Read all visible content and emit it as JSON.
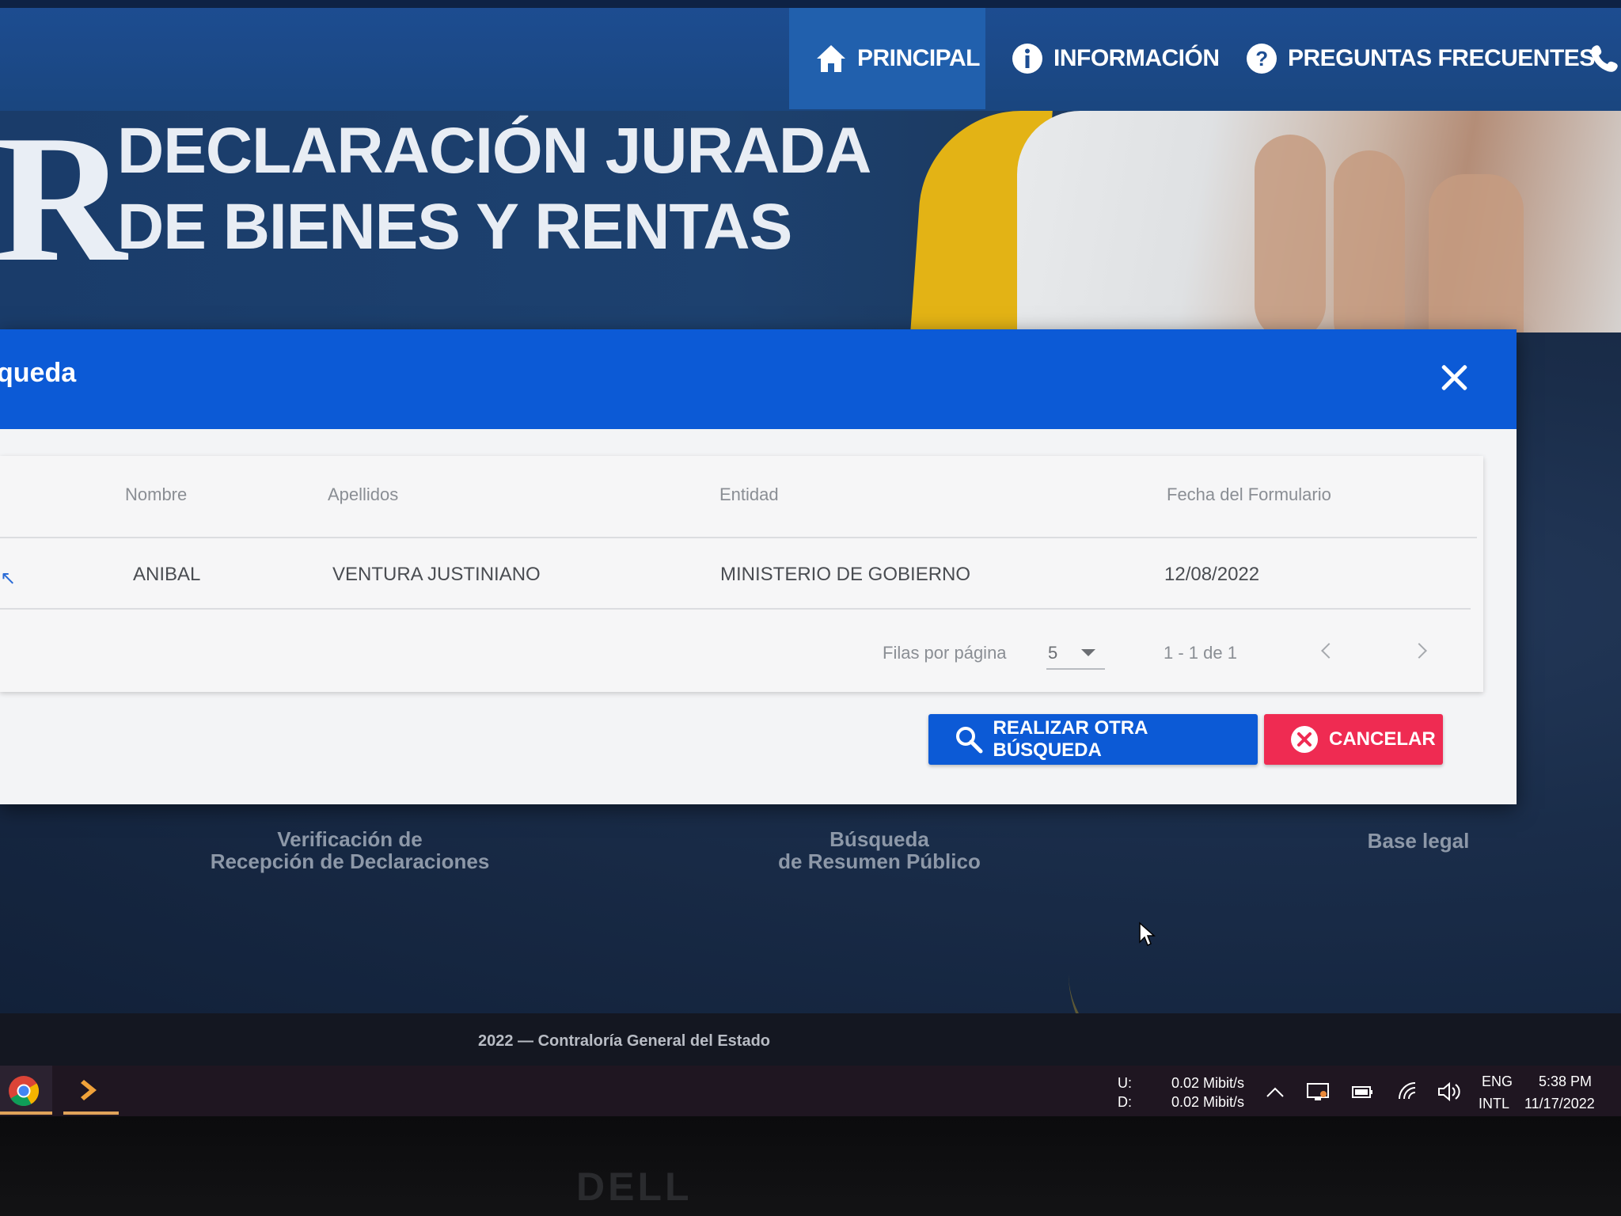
{
  "nav": {
    "principal": "PRINCIPAL",
    "informacion": "INFORMACIÓN",
    "preguntas": "PREGUNTAS FRECUENTES"
  },
  "banner": {
    "logo_letter": "R",
    "title_line1": "DECLARACIÓN JURADA",
    "title_line2": "DE BIENES Y RENTAS"
  },
  "modal": {
    "title": "queda",
    "table": {
      "headers": [
        "Nombre",
        "Apellidos",
        "Entidad",
        "Fecha del Formulario"
      ],
      "rows": [
        {
          "nombre": "ANIBAL",
          "apellidos": "VENTURA JUSTINIANO",
          "entidad": "MINISTERIO DE GOBIERNO",
          "fecha": "12/08/2022"
        }
      ]
    },
    "pagination": {
      "rows_label": "Filas por página",
      "rows_value": "5",
      "range": "1 - 1 de 1"
    },
    "buttons": {
      "search_again": "REALIZAR OTRA BÚSQUEDA",
      "cancel": "CANCELAR"
    }
  },
  "links": {
    "verif_line1": "Verificación de",
    "verif_line2": "Recepción de Declaraciones",
    "busq_line1": "Búsqueda",
    "busq_line2": "de Resumen Público",
    "base_legal": "Base legal"
  },
  "footer": {
    "text": "2022 — Contraloría General del Estado"
  },
  "taskbar": {
    "net_up_label": "U:",
    "net_down_label": "D:",
    "net_up": "0.02 Mibit/s",
    "net_down": "0.02 Mibit/s",
    "lang": "ENG",
    "layout": "INTL",
    "time": "5:38 PM",
    "date": "11/17/2022"
  },
  "hardware": {
    "brand": "DELL"
  },
  "colors": {
    "nav_bg": "#1d4d92",
    "modal_header": "#0c5ad6",
    "cancel_button": "#ef2b52",
    "banner_yellow": "#e3b315"
  },
  "icons": [
    "home-icon",
    "info-icon",
    "question-icon",
    "phone-icon",
    "close-icon",
    "search-icon",
    "cancel-circle-icon",
    "chrome-icon",
    "terminal-icon"
  ]
}
